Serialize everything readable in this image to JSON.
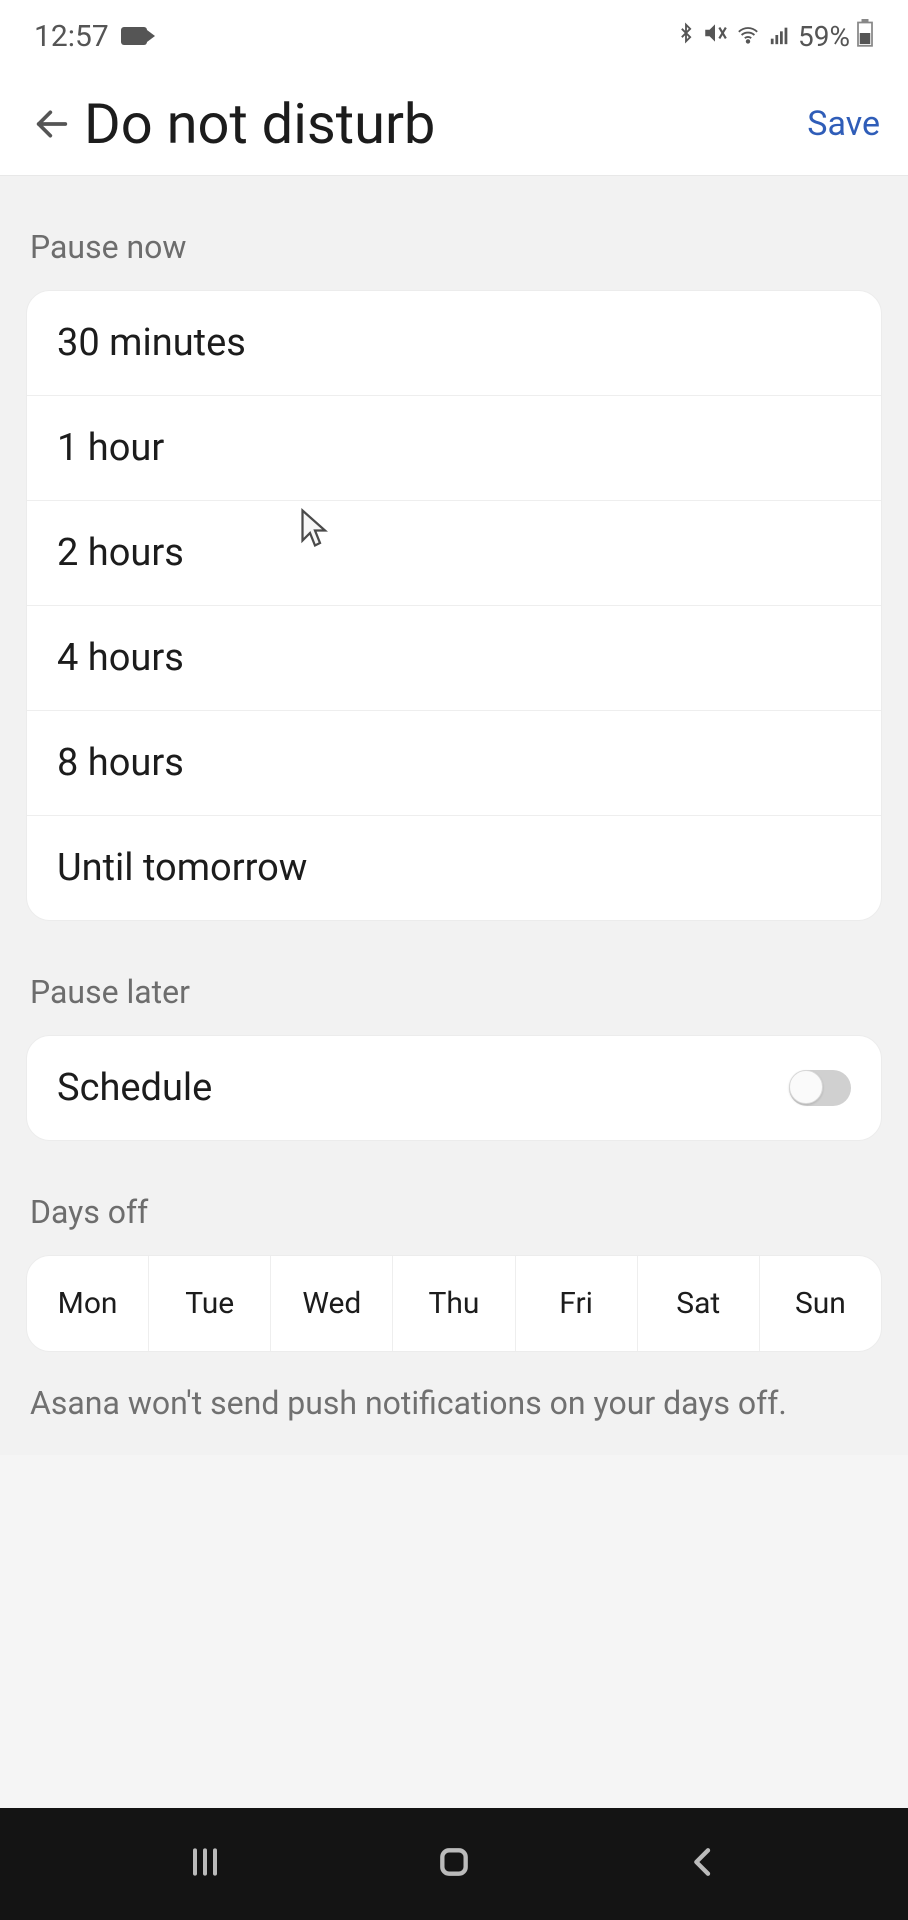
{
  "status": {
    "time": "12:57",
    "battery_text": "59%"
  },
  "header": {
    "title": "Do not disturb",
    "save": "Save"
  },
  "pause_now": {
    "label": "Pause now",
    "options": [
      "30 minutes",
      "1 hour",
      "2 hours",
      "4 hours",
      "8 hours",
      "Until tomorrow"
    ]
  },
  "pause_later": {
    "label": "Pause later",
    "schedule_label": "Schedule",
    "schedule_on": false
  },
  "days_off": {
    "label": "Days off",
    "days": [
      "Mon",
      "Tue",
      "Wed",
      "Thu",
      "Fri",
      "Sat",
      "Sun"
    ],
    "note": "Asana won't send push notifications on your days off."
  }
}
